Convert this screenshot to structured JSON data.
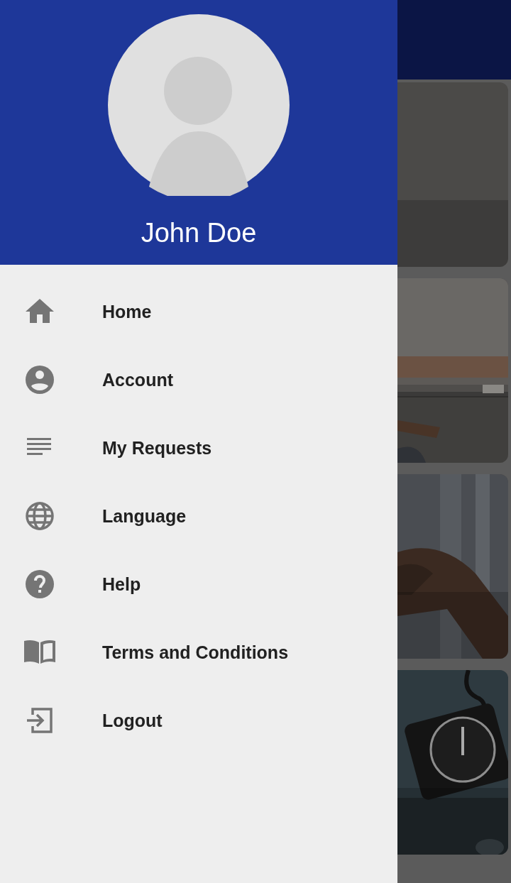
{
  "drawer": {
    "user": {
      "name": "John Doe"
    },
    "menu": [
      {
        "label": "Home"
      },
      {
        "label": "Account"
      },
      {
        "label": "My Requests"
      },
      {
        "label": "Language"
      },
      {
        "label": "Help"
      },
      {
        "label": "Terms and Conditions"
      },
      {
        "label": "Logout"
      }
    ]
  },
  "background": {
    "cards": [
      {
        "kind": "plain"
      },
      {
        "kind": "picture"
      },
      {
        "kind": "picture"
      },
      {
        "kind": "picture"
      }
    ]
  }
}
